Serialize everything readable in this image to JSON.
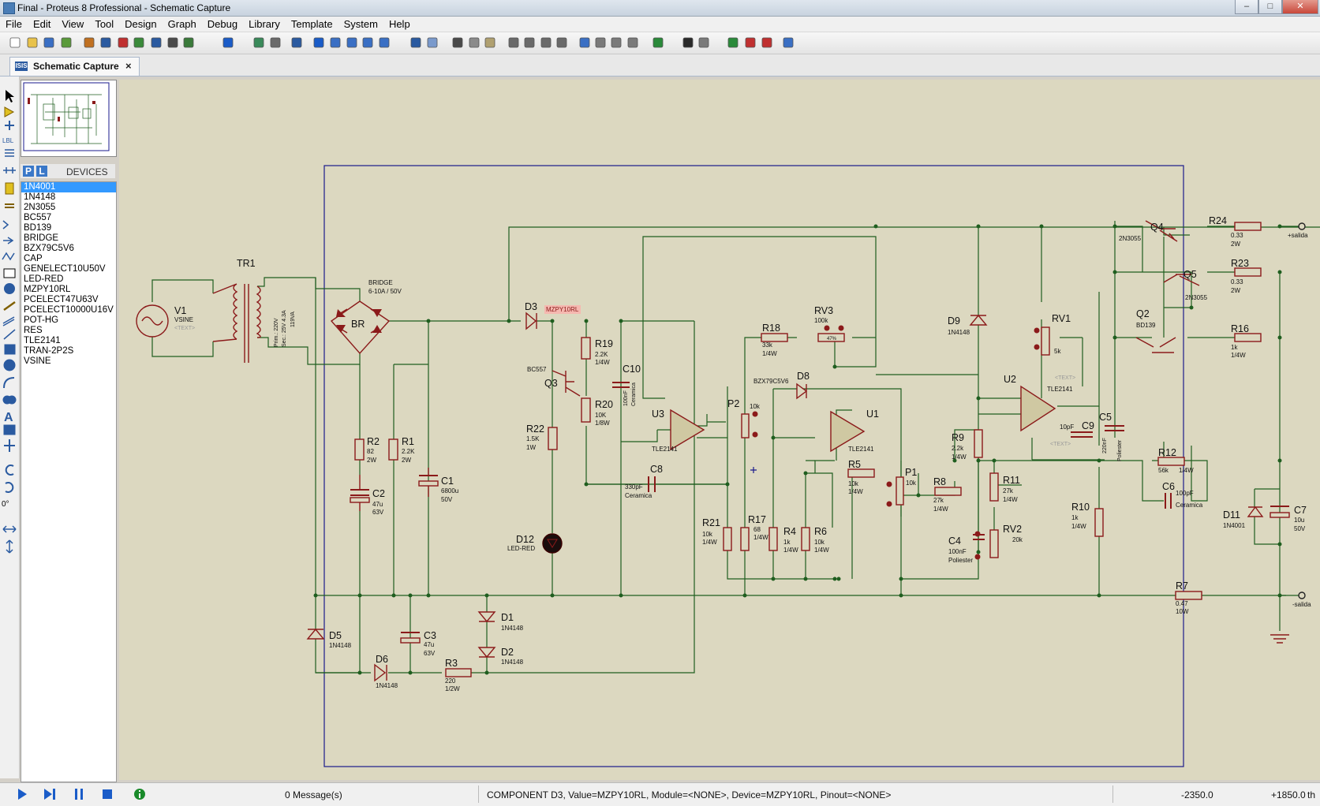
{
  "window": {
    "title": "Final - Proteus 8 Professional - Schematic Capture",
    "minimize": "–",
    "maximize": "□",
    "close": "✕"
  },
  "menu": [
    "File",
    "Edit",
    "View",
    "Tool",
    "Design",
    "Graph",
    "Debug",
    "Library",
    "Template",
    "System",
    "Help"
  ],
  "toolbar_icons": [
    "new-icon",
    "open-icon",
    "save-icon",
    "import-icon",
    "home-icon",
    "isis-icon",
    "ares-icon",
    "export-icon",
    "simulate-icon",
    "bom-icon",
    "run-icon",
    "help-icon",
    "refresh-icon",
    "grid-icon",
    "origin-icon",
    "pan-icon",
    "zoom-in-icon",
    "zoom-out-icon",
    "zoom-all-icon",
    "zoom-area-icon",
    "undo-icon",
    "redo-icon",
    "cut-icon",
    "copy-icon",
    "paste-icon",
    "block-copy-icon",
    "block-move-icon",
    "block-rotate-icon",
    "block-delete-icon",
    "pick-device-icon",
    "make-device-icon",
    "packaging-icon",
    "decompose-icon",
    "wire-autoroute-icon",
    "search-icon",
    "property-icon",
    "new-sheet-icon",
    "remove-sheet-icon",
    "goto-sheet-icon",
    "netlist-icon"
  ],
  "tab": {
    "label": "Schematic Capture",
    "close": "×",
    "icon": "ISIS"
  },
  "devices": {
    "header": "DEVICES",
    "p": "P",
    "l": "L",
    "selected": "1N4001",
    "items": [
      "1N4001",
      "1N4148",
      "2N3055",
      "BC557",
      "BD139",
      "BRIDGE",
      "BZX79C5V6",
      "CAP",
      "GENELECT10U50V",
      "LED-RED",
      "MZPY10RL",
      "PCELECT47U63V",
      "PCELECT10000U16V",
      "POT-HG",
      "RES",
      "TLE2141",
      "TRAN-2P2S",
      "VSINE"
    ]
  },
  "left_tools_rotation": "0°",
  "status": {
    "messages": "0 Message(s)",
    "component": "COMPONENT D3, Value=MZPY10RL, Module=<NONE>, Device=MZPY10RL, Pinout=<NONE>",
    "x": "-2350.0",
    "y": "+1850.0",
    "unit": "th"
  },
  "colors": {
    "canvas": "#dcd8c0",
    "wire": "#1f5e1f",
    "component": "#8b1a1a",
    "sheet_border": "#1a1a8c"
  },
  "schematic": {
    "labels": {
      "V1": "V1",
      "VSINE": "VSINE",
      "TEXT": "<TEXT>",
      "TR1": "TR1",
      "Prim": "Prim.: 220V",
      "Sec": "Sec.: 25V 4.3A",
      "VA": "119VA",
      "BRIDGE": "BRIDGE",
      "BRrating": "6-10A / 50V",
      "BR": "BR",
      "R2": "R2",
      "R2v": "82",
      "R2w": "2W",
      "R1": "R1",
      "R1v": "2.2K",
      "R1w": "2W",
      "C2": "C2",
      "C2v": "47u",
      "C2w": "63V",
      "C1": "C1",
      "C1v": "6800u",
      "C1w": "50V",
      "C3": "C3",
      "C3v": "47u",
      "C3w": "63V",
      "D5": "D5",
      "D5v": "1N4148",
      "D6": "D6",
      "D6v": "1N4148",
      "R3": "R3",
      "R3v": "220",
      "R3w": "1/2W",
      "D1": "D1",
      "D1v": "1N4148",
      "D2": "D2",
      "D2v": "1N4148",
      "D3": "D3",
      "D3v": "MZPY10RL",
      "Q3": "Q3",
      "BC557": "BC557",
      "R19": "R19",
      "R19v": "2.2K",
      "R19w": "1/4W",
      "R20": "R20",
      "R20v": "10K",
      "R20w": "1/8W",
      "C10": "C10",
      "C10v": "100nF",
      "C10w": "Ceramica",
      "R22": "R22",
      "R22v": "1.5K",
      "R22w": "1W",
      "D12": "D12",
      "D12v": "LED-RED",
      "U3": "U3",
      "TLE2141": "TLE2141",
      "C8": "C8",
      "C8v": "330pF",
      "C8w": "Ceramica",
      "P2": "P2",
      "P2v": "10k",
      "R21": "R21",
      "R21v": "10k",
      "R21w": "1/4W",
      "R17": "R17",
      "R17v": "68",
      "R17w": "1/4W",
      "R18": "R18",
      "R18v": "33k",
      "R18w": "1/4W",
      "RV3": "RV3",
      "RV3v": "100k",
      "pct47": "47%",
      "D8": "D8",
      "BZX": "BZX79C5V6",
      "U1": "U1",
      "R5": "R5",
      "R5v": "10k",
      "R5w": "1/4W",
      "R4": "R4",
      "R4v": "1k",
      "R4w": "1/4W",
      "R6": "R6",
      "R6v": "10k",
      "R6w": "1/4W",
      "P1": "P1",
      "P1v": "10k",
      "R8": "R8",
      "R8v": "27k",
      "R8w": "1/4W",
      "D9": "D9",
      "D9v": "1N4148",
      "R9": "R9",
      "R9v": "2.2k",
      "R9w": "1/4W",
      "C4": "C4",
      "C4v": "100nF",
      "C4w": "Poliester",
      "R11": "R11",
      "R11v": "27k",
      "R11w": "1/4W",
      "RV2": "RV2",
      "RV2v": "20k",
      "RV1": "RV1",
      "RV1v": "5k",
      "U2": "U2",
      "C9": "C9",
      "C9v": "10pF",
      "C5": "C5",
      "C5v": "220nF",
      "C5w": "Poliester",
      "R10": "R10",
      "R10v": "1k",
      "R10w": "1/4W",
      "R12": "R12",
      "R12v": "56k",
      "R12w": "1/4W",
      "C6": "C6",
      "C6v": "100pF",
      "C6w": "Ceramica",
      "Q4": "Q4",
      "Q5": "Q5",
      "2N3055": "2N3055",
      "Q2": "Q2",
      "BD139": "BD139",
      "R24": "R24",
      "R24v": "0.33",
      "R24w": "2W",
      "R23": "R23",
      "R23v": "0.33",
      "R23w": "2W",
      "R16": "R16",
      "R16v": "1k",
      "R16w": "1/4W",
      "D11": "D11",
      "D11v": "1N4001",
      "C7": "C7",
      "C7v": "10u",
      "C7w": "50V",
      "R7": "R7",
      "R7v": "0.47",
      "R7w": "10W",
      "salida_pos": "+salida",
      "salida_neg": "-salida"
    }
  }
}
